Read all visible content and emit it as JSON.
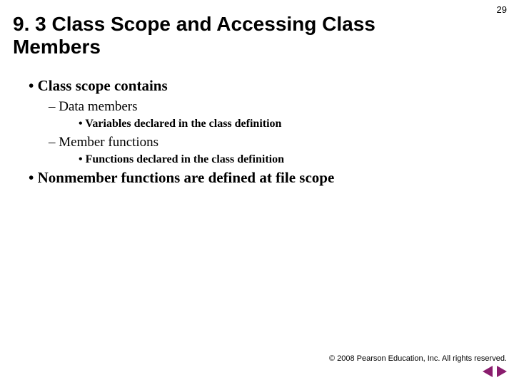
{
  "pageNumber": "29",
  "title": "9. 3 Class Scope and Accessing Class Members",
  "bullets": {
    "b1": "Class scope contains",
    "b1a": "Data members",
    "b1a1": "Variables declared in the class definition",
    "b1b": "Member functions",
    "b1b1": "Functions declared in the class definition",
    "b2": "Nonmember functions are defined at file scope"
  },
  "copyright": "© 2008 Pearson Education, Inc.  All rights reserved."
}
